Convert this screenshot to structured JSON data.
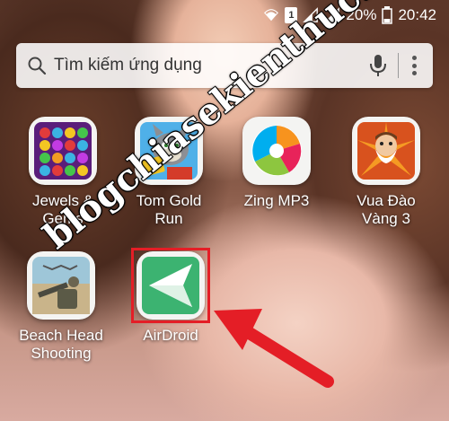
{
  "status_bar": {
    "battery": "20%",
    "time": "20:42",
    "sim": "1",
    "icons": [
      "wifi-icon",
      "sim-icon",
      "signal-icon",
      "signal-icon",
      "battery-icon"
    ]
  },
  "search": {
    "placeholder": "Tìm kiếm ứng dụng",
    "icons": [
      "search-icon",
      "mic-icon",
      "more-icon"
    ]
  },
  "apps": [
    {
      "label": "Jewels &\nGems",
      "icon": "jewels-gems-icon"
    },
    {
      "label": "Tom Gold\nRun",
      "icon": "tom-gold-run-icon"
    },
    {
      "label": "Zing MP3",
      "icon": "zing-mp3-icon"
    },
    {
      "label": "Vua Đào\nVàng 3",
      "icon": "vua-dao-vang-icon"
    },
    {
      "label": "Beach Head\nShooting",
      "icon": "beach-head-icon"
    },
    {
      "label": "AirDroid",
      "icon": "airdroid-icon"
    }
  ],
  "watermark": "blogchiasekienthuc.com",
  "colors": {
    "highlight": "#e41e26",
    "airdroid": "#3cb371"
  }
}
